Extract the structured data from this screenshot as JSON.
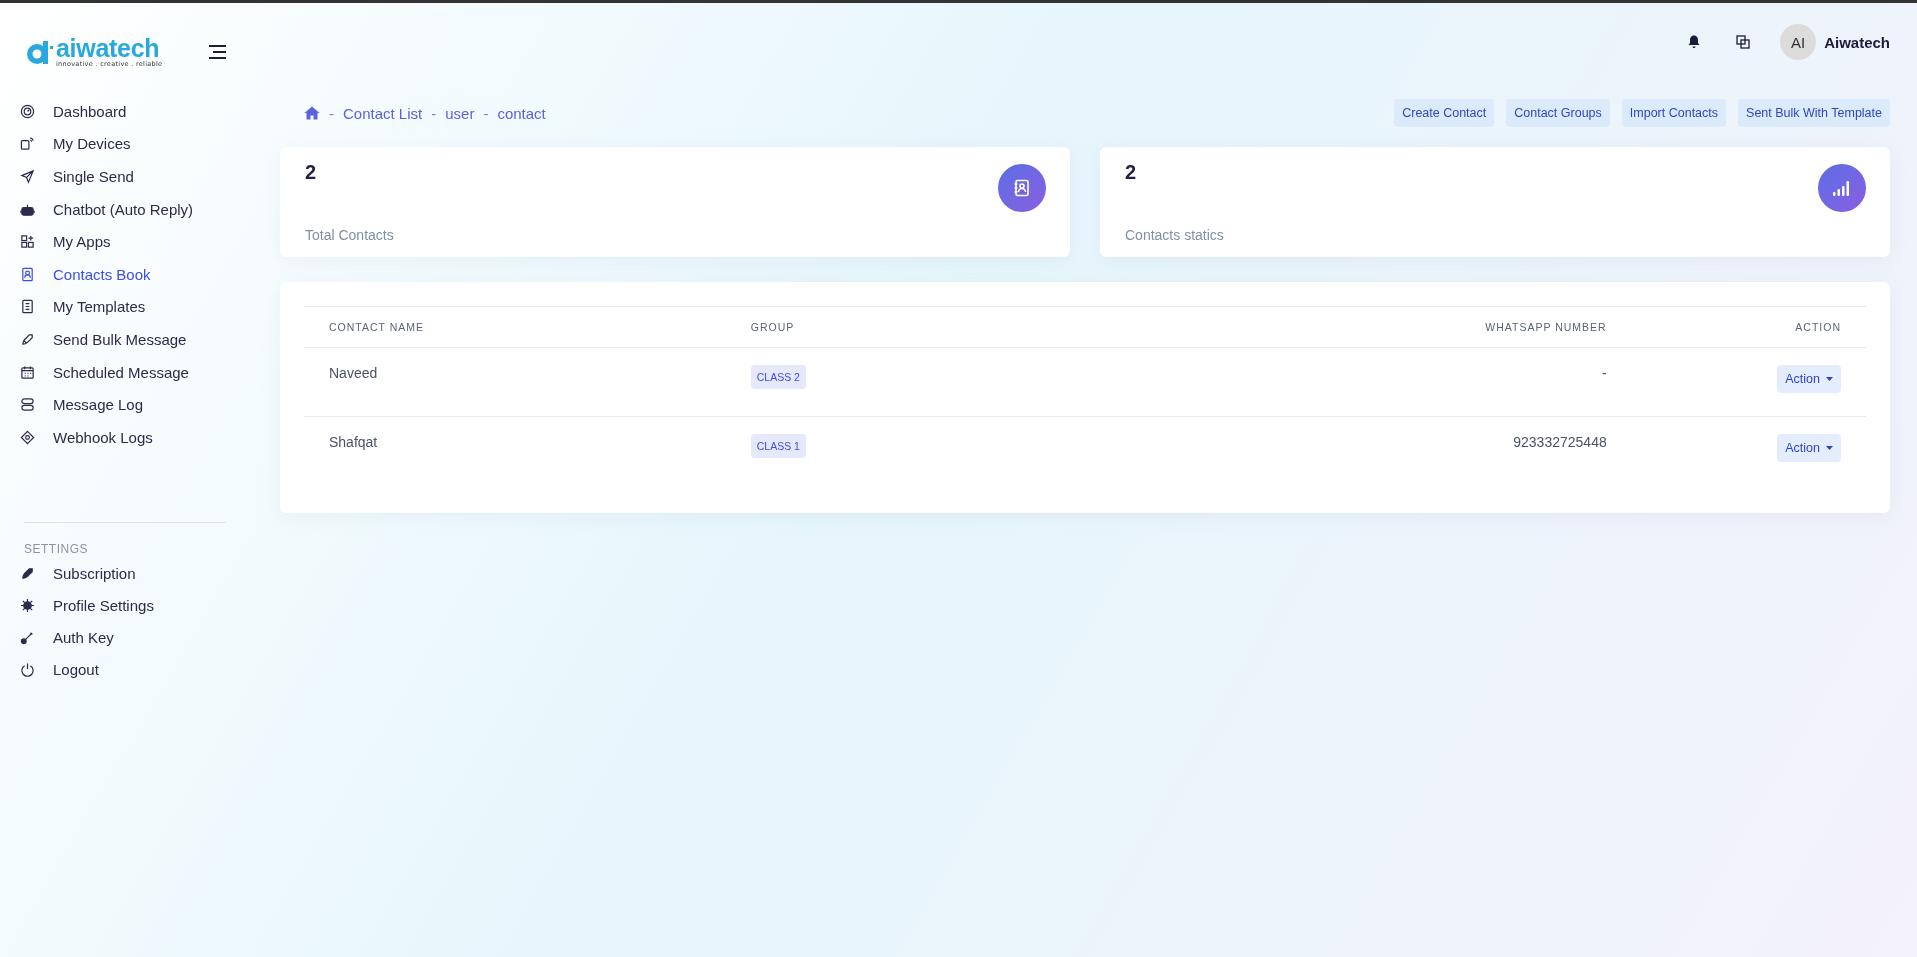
{
  "brand": {
    "name": "aiwatech",
    "tagline": "innovative . creative . reliable"
  },
  "user": {
    "initials": "AI",
    "name": "Aiwatech"
  },
  "sidebar": {
    "items": [
      {
        "label": "Dashboard",
        "selected": false
      },
      {
        "label": "My Devices",
        "selected": false
      },
      {
        "label": "Single Send",
        "selected": false
      },
      {
        "label": "Chatbot (Auto Reply)",
        "selected": false
      },
      {
        "label": "My Apps",
        "selected": false
      },
      {
        "label": "Contacts Book",
        "selected": true
      },
      {
        "label": "My Templates",
        "selected": false
      },
      {
        "label": "Send Bulk Message",
        "selected": false
      },
      {
        "label": "Scheduled Message",
        "selected": false
      },
      {
        "label": "Message Log",
        "selected": false
      },
      {
        "label": "Webhook Logs",
        "selected": false
      }
    ],
    "settings_heading": "SETTINGS",
    "settings_items": [
      {
        "label": "Subscription",
        "selected": false
      },
      {
        "label": "Profile Settings",
        "selected": false
      },
      {
        "label": "Auth Key",
        "selected": false
      },
      {
        "label": "Logout",
        "selected": false
      }
    ]
  },
  "breadcrumb": [
    "Contact List",
    "user",
    "contact"
  ],
  "breadcrumb_separator": "-",
  "actions": [
    "Create Contact",
    "Contact Groups",
    "Import Contacts",
    "Sent Bulk With Template"
  ],
  "stats": [
    {
      "value": "2",
      "label": "Total Contacts"
    },
    {
      "value": "2",
      "label": "Contacts statics"
    }
  ],
  "table": {
    "columns": [
      "CONTACT NAME",
      "GROUP",
      "WHATSAPP NUMBER",
      "ACTION"
    ],
    "rows": [
      {
        "name": "Naveed",
        "group": "CLASS 2",
        "number": "-",
        "action": "Action"
      },
      {
        "name": "Shafqat",
        "group": "CLASS 1",
        "number": "923332725448",
        "action": "Action"
      }
    ]
  }
}
